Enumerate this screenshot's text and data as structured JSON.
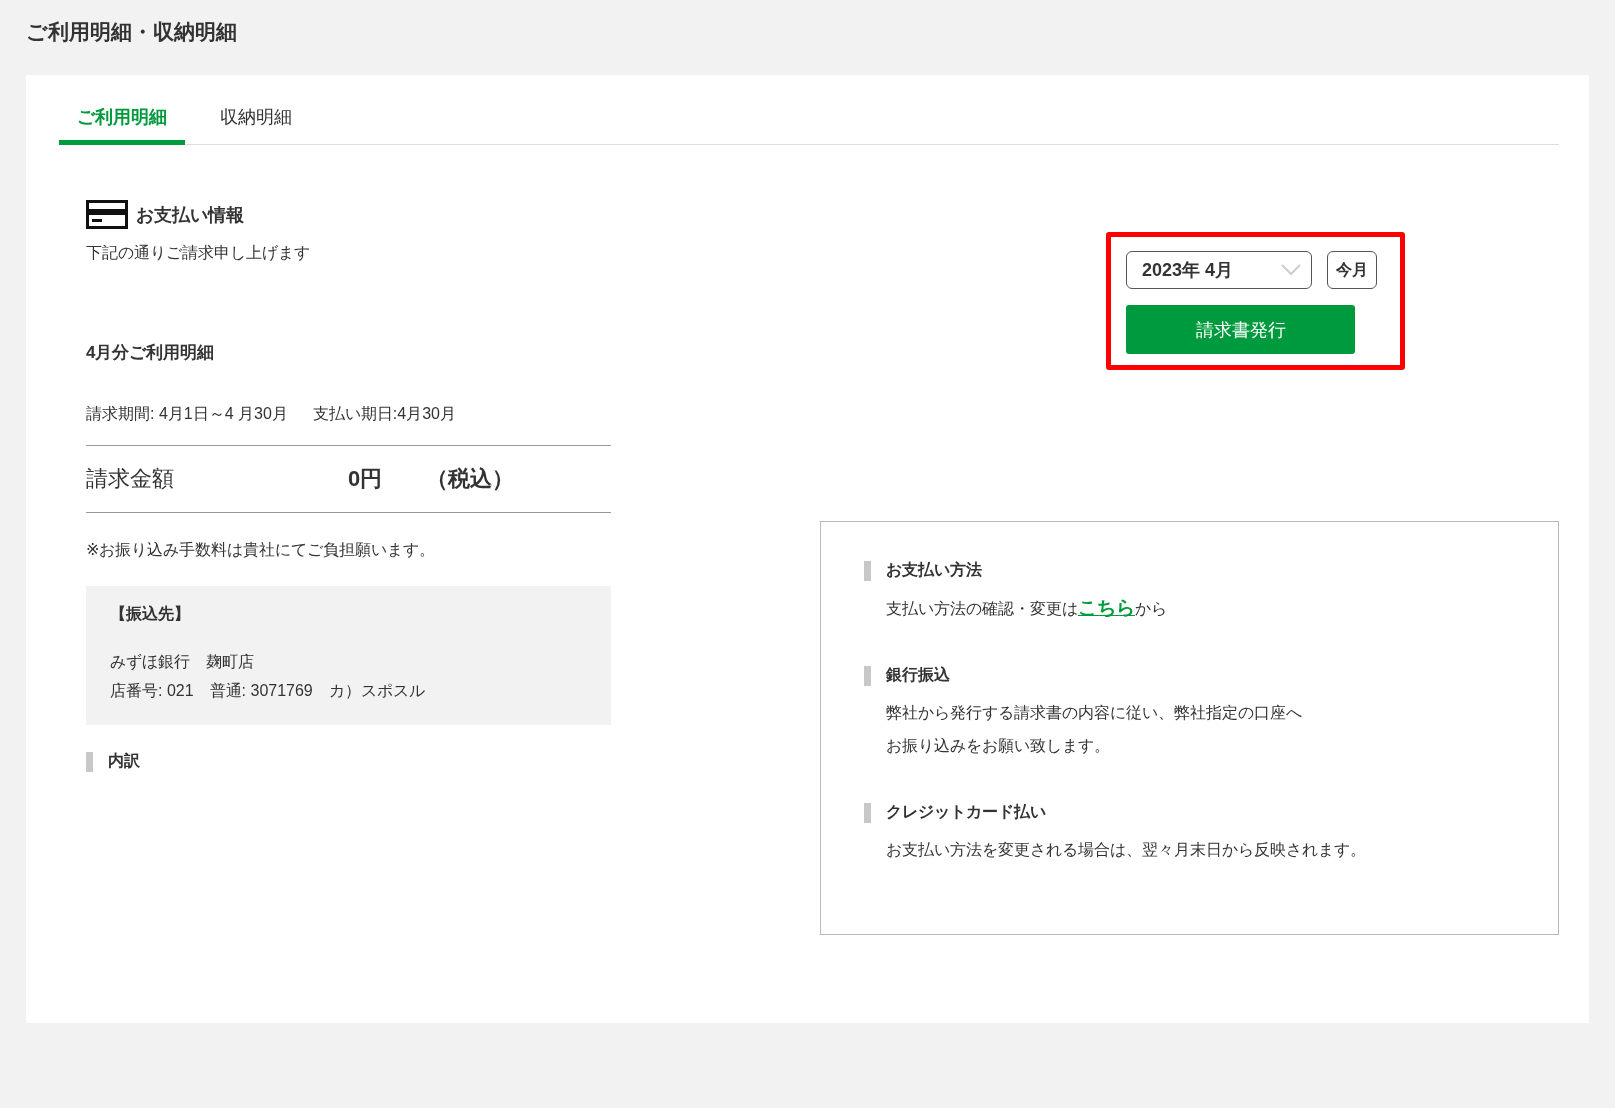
{
  "page_title": "ご利用明細・収納明細",
  "tabs": [
    {
      "label": "ご利用明細",
      "selected": true
    },
    {
      "label": "収納明細",
      "selected": false
    }
  ],
  "payment_info": {
    "title": "お支払い情報",
    "subtitle": "下記の通りご請求申し上げます"
  },
  "statement": {
    "title": "4月分ご利用明細",
    "period": "請求期間: 4月1日～4 月30月",
    "due_date": "支払い期日:4月30月",
    "amount_label": "請求金額",
    "amount": "0円",
    "tax_note": "（税込）",
    "fee_note": "※お振り込み手数料は貴社にてご負担願います。"
  },
  "transfer_to": {
    "title": "【振込先】",
    "lines": [
      "みずほ銀行　麹町店",
      "店番号: 021　普通: 3071769　カ）スポスル"
    ]
  },
  "breakdown_title": "内訳",
  "controls": {
    "month_select": {
      "value": "2023年 4月"
    },
    "this_month_button": "今月",
    "issue_button": "請求書発行"
  },
  "payment_methods": [
    {
      "kind": "link",
      "title": "お支払い方法",
      "before": "支払い方法の確認・変更は",
      "link": "こちら",
      "after": "から"
    },
    {
      "kind": "text",
      "title": "銀行振込",
      "lines": [
        "弊社から発行する請求書の内容に従い、弊社指定の口座へ",
        "お振り込みをお願い致します。"
      ]
    },
    {
      "kind": "text",
      "title": "クレジットカード払い",
      "lines": [
        "お支払い方法を変更される場合は、翌々月末日から反映されます。"
      ]
    }
  ]
}
